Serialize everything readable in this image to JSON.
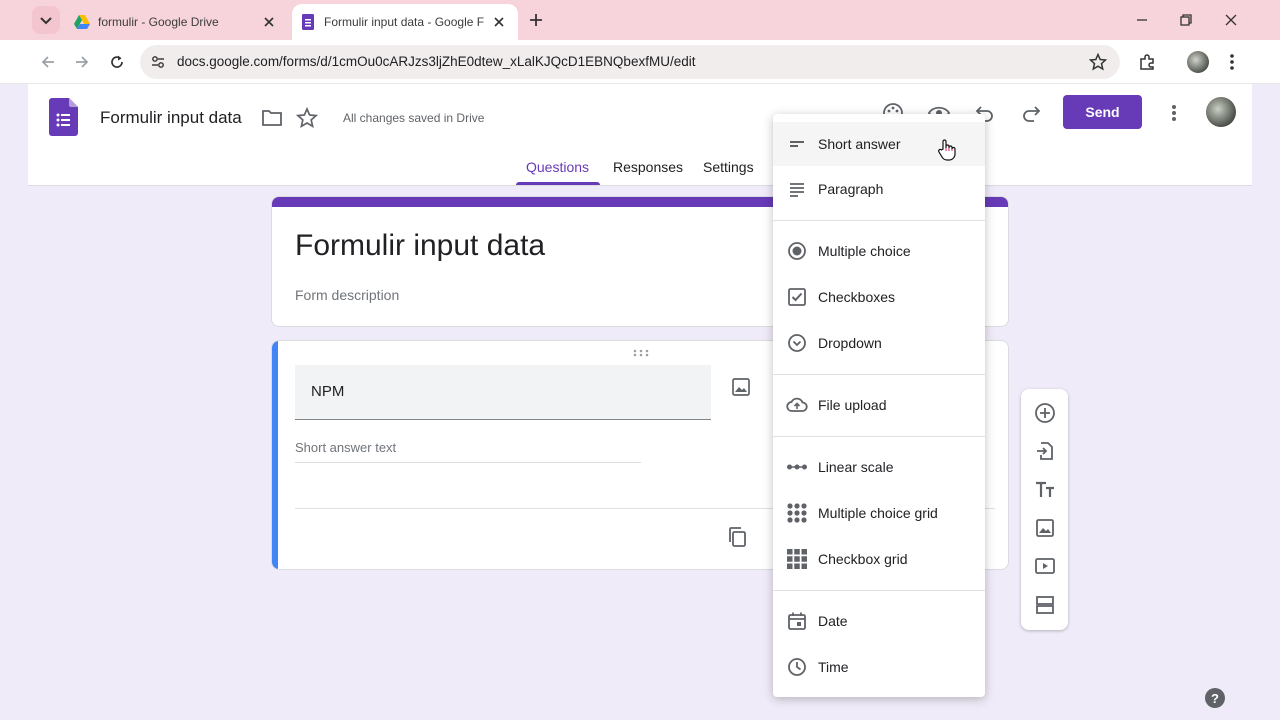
{
  "browser": {
    "tabs": [
      {
        "title": "formulir - Google Drive",
        "active": false,
        "icon": "google-drive-icon"
      },
      {
        "title": "Formulir input data - Google Fo",
        "active": true,
        "icon": "google-forms-icon"
      }
    ],
    "url": "docs.google.com/forms/d/1cmOu0cARJzs3ljZhE0dtew_xLalKJQcD1EBNQbexfMU/edit"
  },
  "header": {
    "doc_title": "Formulir input data",
    "saved_status": "All changes saved in Drive",
    "send_label": "Send",
    "accent": "#673ab7"
  },
  "tabs": [
    {
      "label": "Questions",
      "active": true
    },
    {
      "label": "Responses",
      "active": false
    },
    {
      "label": "Settings",
      "active": false
    }
  ],
  "form": {
    "title": "Formulir input data",
    "description_placeholder": "Form description"
  },
  "question": {
    "title": "NPM",
    "answer_placeholder": "Short answer text"
  },
  "question_type_menu": {
    "groups": [
      [
        {
          "label": "Short answer",
          "icon": "short-answer-icon",
          "highlighted": true
        },
        {
          "label": "Paragraph",
          "icon": "paragraph-icon"
        }
      ],
      [
        {
          "label": "Multiple choice",
          "icon": "radio-icon"
        },
        {
          "label": "Checkboxes",
          "icon": "checkbox-icon"
        },
        {
          "label": "Dropdown",
          "icon": "dropdown-icon"
        }
      ],
      [
        {
          "label": "File upload",
          "icon": "cloud-upload-icon"
        }
      ],
      [
        {
          "label": "Linear scale",
          "icon": "linear-scale-icon"
        },
        {
          "label": "Multiple choice grid",
          "icon": "dot-grid-icon"
        },
        {
          "label": "Checkbox grid",
          "icon": "square-grid-icon"
        }
      ],
      [
        {
          "label": "Date",
          "icon": "calendar-icon"
        },
        {
          "label": "Time",
          "icon": "clock-icon"
        }
      ]
    ]
  },
  "help_label": "?"
}
